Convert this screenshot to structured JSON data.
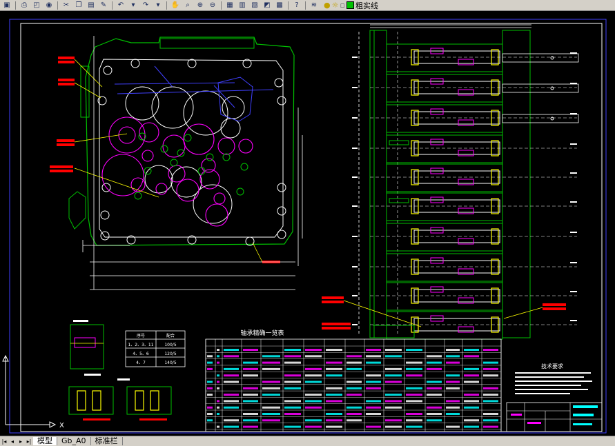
{
  "toolbar": {
    "icons": [
      "save-icon",
      "print-icon",
      "preview-icon",
      "publish-icon",
      "cut-icon",
      "copy-icon",
      "paste-icon",
      "match-properties-icon",
      "undo-icon",
      "redo-icon",
      "pan-icon",
      "zoom-realtime-icon",
      "zoom-window-icon",
      "zoom-previous-icon",
      "properties-icon",
      "design-center-icon",
      "tool-palettes-icon",
      "markup-icon",
      "calculator-icon",
      "help-icon",
      "layers-icon"
    ],
    "current_layer": "粗实线",
    "layer_color": "#00c000"
  },
  "drawing": {
    "table_title": "轴承精确一览表",
    "tech_req_title": "技术要求",
    "small_table": {
      "header": [
        "序号",
        "配合"
      ],
      "rows": [
        [
          "1、2、3、11",
          "100/5"
        ],
        [
          "4、5、6",
          "120/5"
        ],
        [
          "4、7",
          "140/5"
        ]
      ]
    },
    "coord_x_label": "X",
    "colors": {
      "green": "#00c000",
      "white": "#ffffff",
      "magenta": "#ff00ff",
      "blue": "#4040ff",
      "red": "#ff0000",
      "yellow": "#ffff00",
      "cyan": "#00ffff"
    }
  },
  "tabs": {
    "items": [
      "模型",
      "Gb_A0",
      "标准栏"
    ],
    "active": "模型"
  }
}
